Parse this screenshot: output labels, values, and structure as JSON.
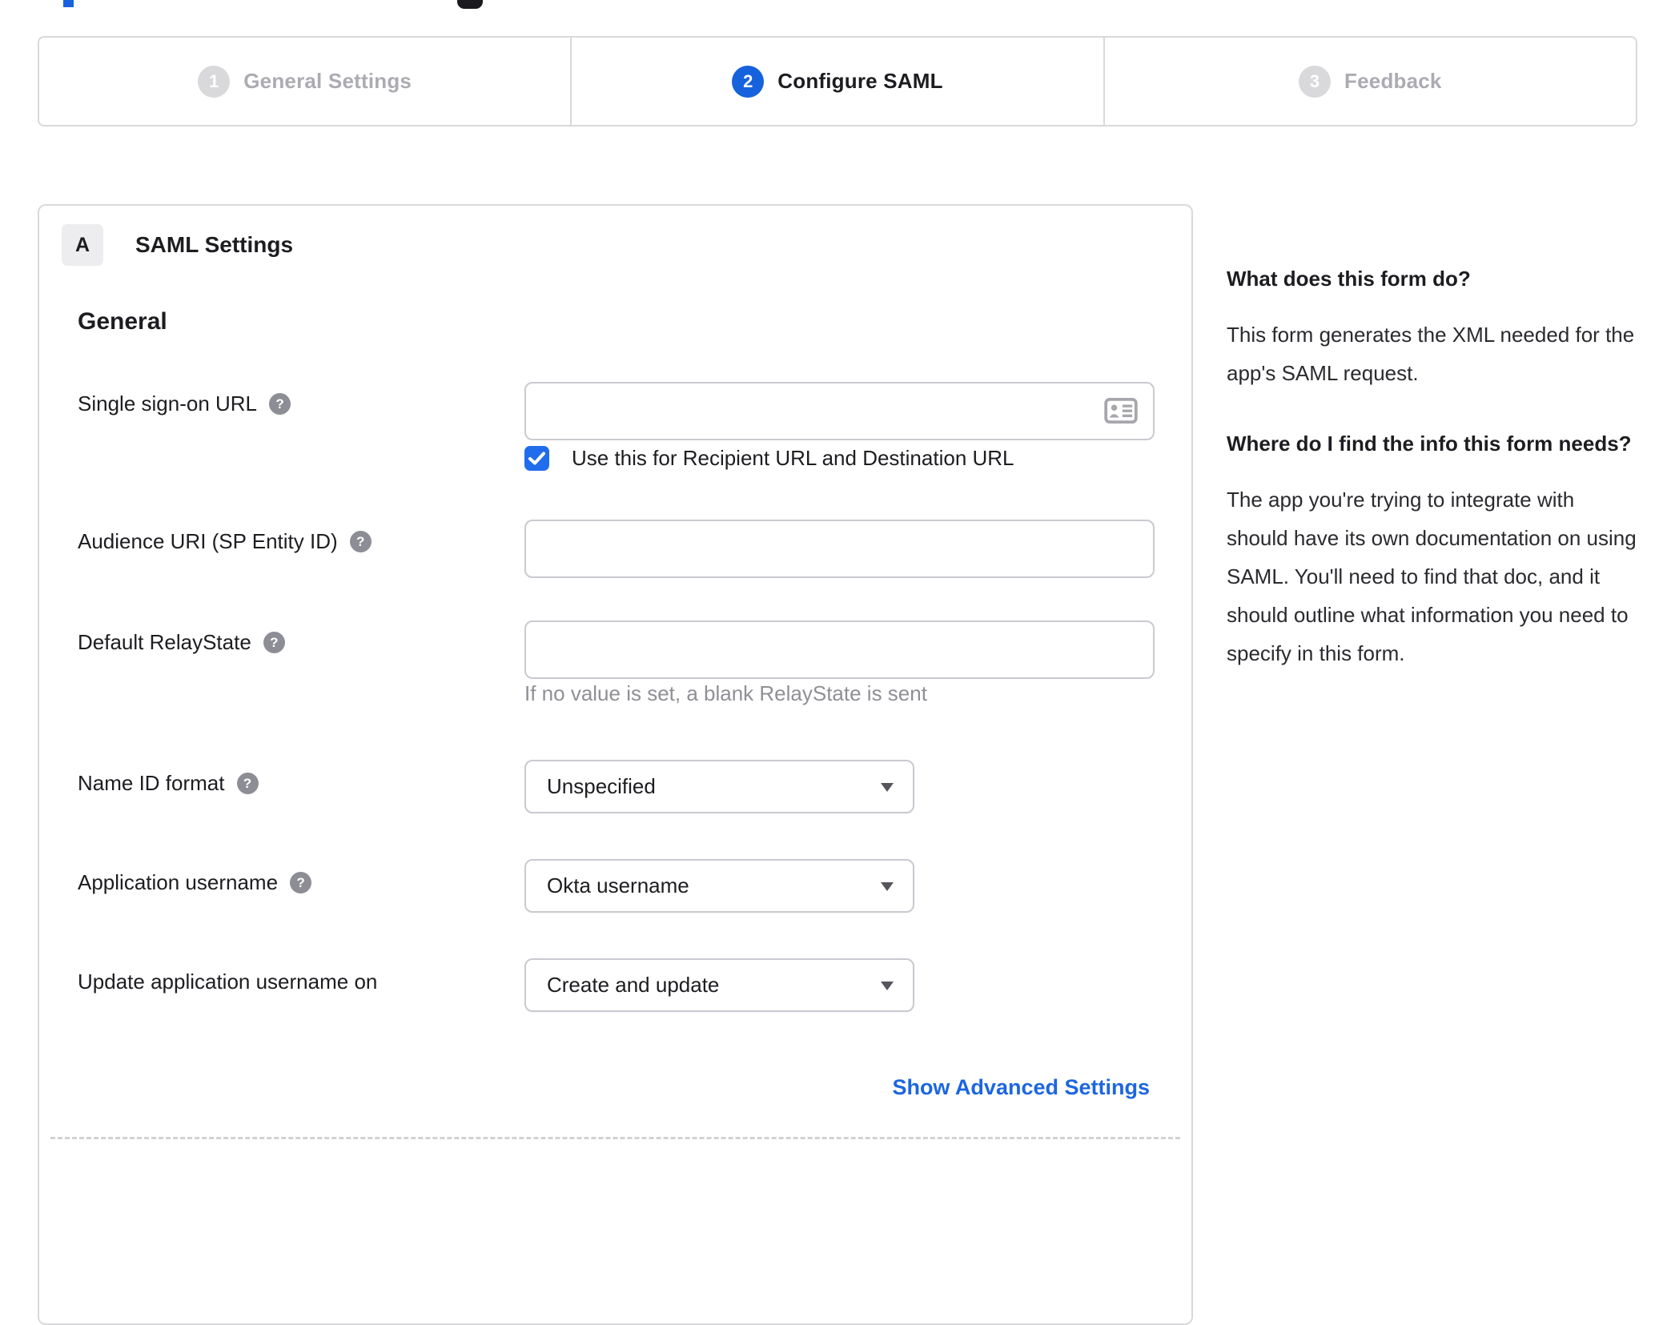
{
  "page": {
    "top_fragments": {
      "blue_fragment_color": "#1662dd",
      "dark_fragment_color": "#1a1a1f"
    }
  },
  "stepper": {
    "steps": [
      {
        "number": "1",
        "label": "General Settings",
        "state": "inactive"
      },
      {
        "number": "2",
        "label": "Configure SAML",
        "state": "active"
      },
      {
        "number": "3",
        "label": "Feedback",
        "state": "inactive"
      }
    ]
  },
  "form": {
    "section_badge": "A",
    "section_title": "SAML Settings",
    "group_title": "General",
    "sso": {
      "label": "Single sign-on URL",
      "value": "",
      "checkbox_label": "Use this for Recipient URL and Destination URL",
      "checkbox_checked": true
    },
    "audience": {
      "label": "Audience URI (SP Entity ID)",
      "value": ""
    },
    "relaystate": {
      "label": "Default RelayState",
      "value": "",
      "hint": "If no value is set, a blank RelayState is sent"
    },
    "name_id": {
      "label": "Name ID format",
      "value": "Unspecified"
    },
    "app_username": {
      "label": "Application username",
      "value": "Okta username"
    },
    "update_username": {
      "label": "Update application username on",
      "value": "Create and update"
    },
    "advanced_link": "Show Advanced Settings"
  },
  "sidebar": {
    "block1": {
      "heading": "What does this form do?",
      "body": "This form generates the XML needed for the app's SAML request."
    },
    "block2": {
      "heading": "Where do I find the info this form needs?",
      "body": "The app you're trying to integrate with should have its own documentation on using SAML. You'll need to find that doc, and it should outline what information you need to specify in this form."
    }
  },
  "icons": {
    "help": "?",
    "contact_card": "contact-card-icon",
    "checkmark": "check-icon",
    "dropdown_arrow": "dropdown-arrow-icon"
  },
  "colors": {
    "accent_blue": "#1662dd",
    "checkbox_blue": "#1f6ced",
    "link_blue": "#1c66e0",
    "border_gray": "#d9d9db",
    "input_border": "#cacad0",
    "text_dark": "#1d1d21",
    "inactive_gray": "#ababb1",
    "hint_gray": "#8f8f96"
  }
}
